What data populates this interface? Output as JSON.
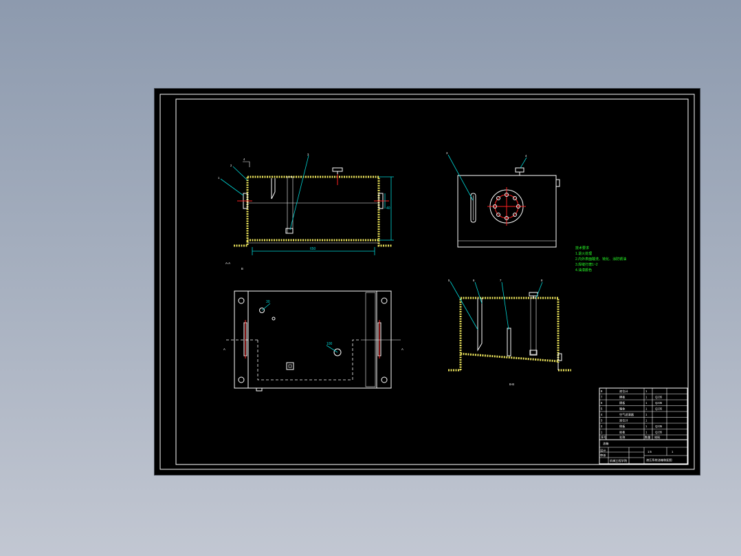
{
  "colors": {
    "background": "#000000",
    "line": "#ffffff",
    "wall": "#e8e05a",
    "dimension": "#00d8d8",
    "centerline": "#ff2020",
    "notes": "#28ff28"
  },
  "front_view": {
    "section_label": "A-A",
    "callouts": [
      "1",
      "2",
      "3",
      "4"
    ],
    "dimension_length": "650",
    "dimension_height": "40"
  },
  "side_view": {
    "callouts": [
      "3",
      "4"
    ]
  },
  "plan_view": {
    "section_marks": [
      "A",
      "A"
    ],
    "dimensions": [
      "30",
      "100"
    ]
  },
  "section_view": {
    "callouts": [
      "5",
      "6",
      "7",
      "8"
    ],
    "label": "B-B"
  },
  "notes": {
    "title": "技术要求",
    "items": [
      "1.退火处理",
      "2.内外表面酸洗、钝化、涂防锈油",
      "3.焊缝打磨1~2",
      "4.油漆颜色"
    ]
  },
  "title_block": {
    "bom_rows": [
      {
        "no": "8",
        "name": "液位计",
        "qty": "1",
        "mat": ""
      },
      {
        "no": "7",
        "name": "隔板",
        "qty": "1",
        "mat": "Q235"
      },
      {
        "no": "6",
        "name": "隔板",
        "qty": "1",
        "mat": "Q235"
      },
      {
        "no": "5",
        "name": "箱体",
        "qty": "1",
        "mat": "Q235"
      },
      {
        "no": "4",
        "name": "空气滤清器",
        "qty": "1",
        "mat": ""
      },
      {
        "no": "3",
        "name": "液位计",
        "qty": "1",
        "mat": ""
      },
      {
        "no": "2",
        "name": "侧板",
        "qty": "1",
        "mat": "Q235"
      },
      {
        "no": "1",
        "name": "底板",
        "qty": "1",
        "mat": "Q235"
      }
    ],
    "header": {
      "no": "序号",
      "name": "名称",
      "qty": "数量",
      "mat": "材料"
    },
    "drawing_name": "油箱",
    "scale": "1:5",
    "sheet": "1",
    "designer": "设计",
    "checker": "审核",
    "school": "机械工程学院",
    "title": "液压系统油箱装配图"
  }
}
